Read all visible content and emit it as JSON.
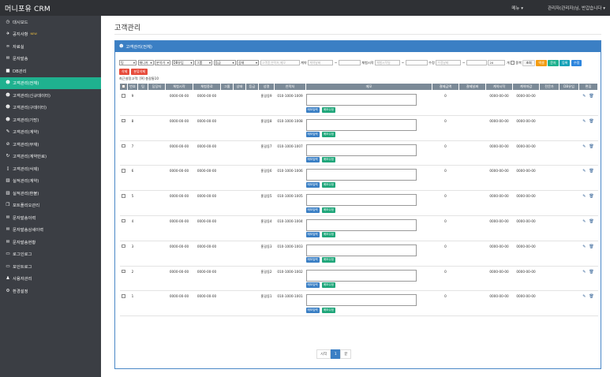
{
  "app": {
    "brand": "머니포유 CRM",
    "menu": "메뉴",
    "user": "관리자(관리자)님, 반갑습니다"
  },
  "sidebar": {
    "items": [
      {
        "label": "대시보드",
        "icon": "dashboard-icon",
        "glyph": "◷"
      },
      {
        "label": "공지사항",
        "icon": "megaphone-icon",
        "glyph": "✈",
        "badge": "NEW"
      },
      {
        "label": "자료실",
        "icon": "link-icon",
        "glyph": "∞"
      },
      {
        "label": "문자발송",
        "icon": "envelope-icon",
        "glyph": "✉"
      },
      {
        "label": "DB관리",
        "icon": "database-icon",
        "glyph": "■"
      },
      {
        "label": "고객관리(전체)",
        "icon": "users-icon",
        "glyph": "☻",
        "active": true
      },
      {
        "label": "고객관리(신규데이터)",
        "icon": "users-icon",
        "glyph": "☻"
      },
      {
        "label": "고객관리(구데이터)",
        "icon": "users-icon",
        "glyph": "☻"
      },
      {
        "label": "고객관리(가망)",
        "icon": "users-icon",
        "glyph": "☻"
      },
      {
        "label": "고객관리(계약)",
        "icon": "handshake-icon",
        "glyph": "✎"
      },
      {
        "label": "고객관리(부재)",
        "icon": "ban-icon",
        "glyph": "⊘"
      },
      {
        "label": "고객관리(계약만료)",
        "icon": "refresh-icon",
        "glyph": "↻"
      },
      {
        "label": "고객관리(삭제)",
        "icon": "trash-icon",
        "glyph": "▯"
      },
      {
        "label": "실적관리(계약)",
        "icon": "chart-icon",
        "glyph": "▥"
      },
      {
        "label": "실적관리(환불)",
        "icon": "chart-icon",
        "glyph": "▥"
      },
      {
        "label": "포트폴리오관리",
        "icon": "briefcase-icon",
        "glyph": "❒"
      },
      {
        "label": "문자발송이력",
        "icon": "envelope-icon",
        "glyph": "✉"
      },
      {
        "label": "문자발송상세이력",
        "icon": "envelope-icon",
        "glyph": "✉"
      },
      {
        "label": "문자발송현황",
        "icon": "envelope-icon",
        "glyph": "✉"
      },
      {
        "label": "로그인로그",
        "icon": "log-icon",
        "glyph": "▭"
      },
      {
        "label": "포인트로그",
        "icon": "log-icon",
        "glyph": "▭"
      },
      {
        "label": "사용자관리",
        "icon": "user-icon",
        "glyph": "♟"
      },
      {
        "label": "환경설정",
        "icon": "gear-icon",
        "glyph": "⚙"
      }
    ]
  },
  "page": {
    "title": "고객관리",
    "panel_title": "고객관리(전체)"
  },
  "filters": {
    "sel1": "팀",
    "sel2": "매니저",
    "sel3": "분석가",
    "sel4": "DB유입",
    "sel5": "그룹",
    "sel6": "등급",
    "sel7": "상태",
    "search_placeholder": "고객명,연락처,메모",
    "contract_label": "계약",
    "contract_from": "계약날짜",
    "sep": "~",
    "service_label": "체험시작",
    "service_from": "체험시작일",
    "revenue_label": "수정",
    "revenue_from": "수정날짜",
    "count": "20",
    "count_unit": "개",
    "dup_label": "중복",
    "btn_reset": "초회",
    "btn_excel": "엑셀",
    "btn_sms": "문자",
    "btn_register": "등록",
    "btn_assign": "수정",
    "btn_delete": "삭제",
    "btn_select_delete": "분류삭제"
  },
  "count_line": "최근설정고객: [9] 총갈통10",
  "table": {
    "headers": [
      "번호",
      "팀",
      "담당자",
      "체험시작",
      "체험종료",
      "그룹",
      "상태",
      "등급",
      "성명",
      "연락처",
      "메모",
      "결제금액",
      "결제날짜",
      "계약시작",
      "계약마감",
      "전문가",
      "DB유입",
      "편집"
    ],
    "memo_in": "메모입력",
    "memo_edit": "메모수정",
    "rows": [
      {
        "no": "9",
        "start": "0000-00-00",
        "end": "0000-00-00",
        "name": "홍길동9",
        "phone": "010-1000-1009",
        "amount": "0",
        "cstart": "0000-00-00",
        "cend": "0000-00-00"
      },
      {
        "no": "8",
        "start": "0000-00-00",
        "end": "0000-00-00",
        "name": "홍길동8",
        "phone": "010-1000-1008",
        "amount": "0",
        "cstart": "0000-00-00",
        "cend": "0000-00-00"
      },
      {
        "no": "7",
        "start": "0000-00-00",
        "end": "0000-00-00",
        "name": "홍길동7",
        "phone": "010-1000-1007",
        "amount": "0",
        "cstart": "0000-00-00",
        "cend": "0000-00-00"
      },
      {
        "no": "6",
        "start": "0000-00-00",
        "end": "0000-00-00",
        "name": "홍길동6",
        "phone": "010-1000-1006",
        "amount": "0",
        "cstart": "0000-00-00",
        "cend": "0000-00-00"
      },
      {
        "no": "5",
        "start": "0000-00-00",
        "end": "0000-00-00",
        "name": "홍길동5",
        "phone": "010-1000-1005",
        "amount": "0",
        "cstart": "0000-00-00",
        "cend": "0000-00-00"
      },
      {
        "no": "4",
        "start": "0000-00-00",
        "end": "0000-00-00",
        "name": "홍길동4",
        "phone": "010-1000-1004",
        "amount": "0",
        "cstart": "0000-00-00",
        "cend": "0000-00-00"
      },
      {
        "no": "3",
        "start": "0000-00-00",
        "end": "0000-00-00",
        "name": "홍길동3",
        "phone": "010-1000-1003",
        "amount": "0",
        "cstart": "0000-00-00",
        "cend": "0000-00-00"
      },
      {
        "no": "2",
        "start": "0000-00-00",
        "end": "0000-00-00",
        "name": "홍길동2",
        "phone": "010-1000-1002",
        "amount": "0",
        "cstart": "0000-00-00",
        "cend": "0000-00-00"
      },
      {
        "no": "1",
        "start": "0000-00-00",
        "end": "0000-00-00",
        "name": "홍길동1",
        "phone": "010-1000-1001",
        "amount": "0",
        "cstart": "0000-00-00",
        "cend": "0000-00-00"
      }
    ]
  },
  "pagination": {
    "first": "시작",
    "current": "1",
    "last": "끝"
  },
  "colors": {
    "topbar": "#2f3135",
    "sidebar": "#3b3e44",
    "active": "#1fb18f",
    "panel_head": "#3b7fc4",
    "table_head": "#7b8a97"
  }
}
